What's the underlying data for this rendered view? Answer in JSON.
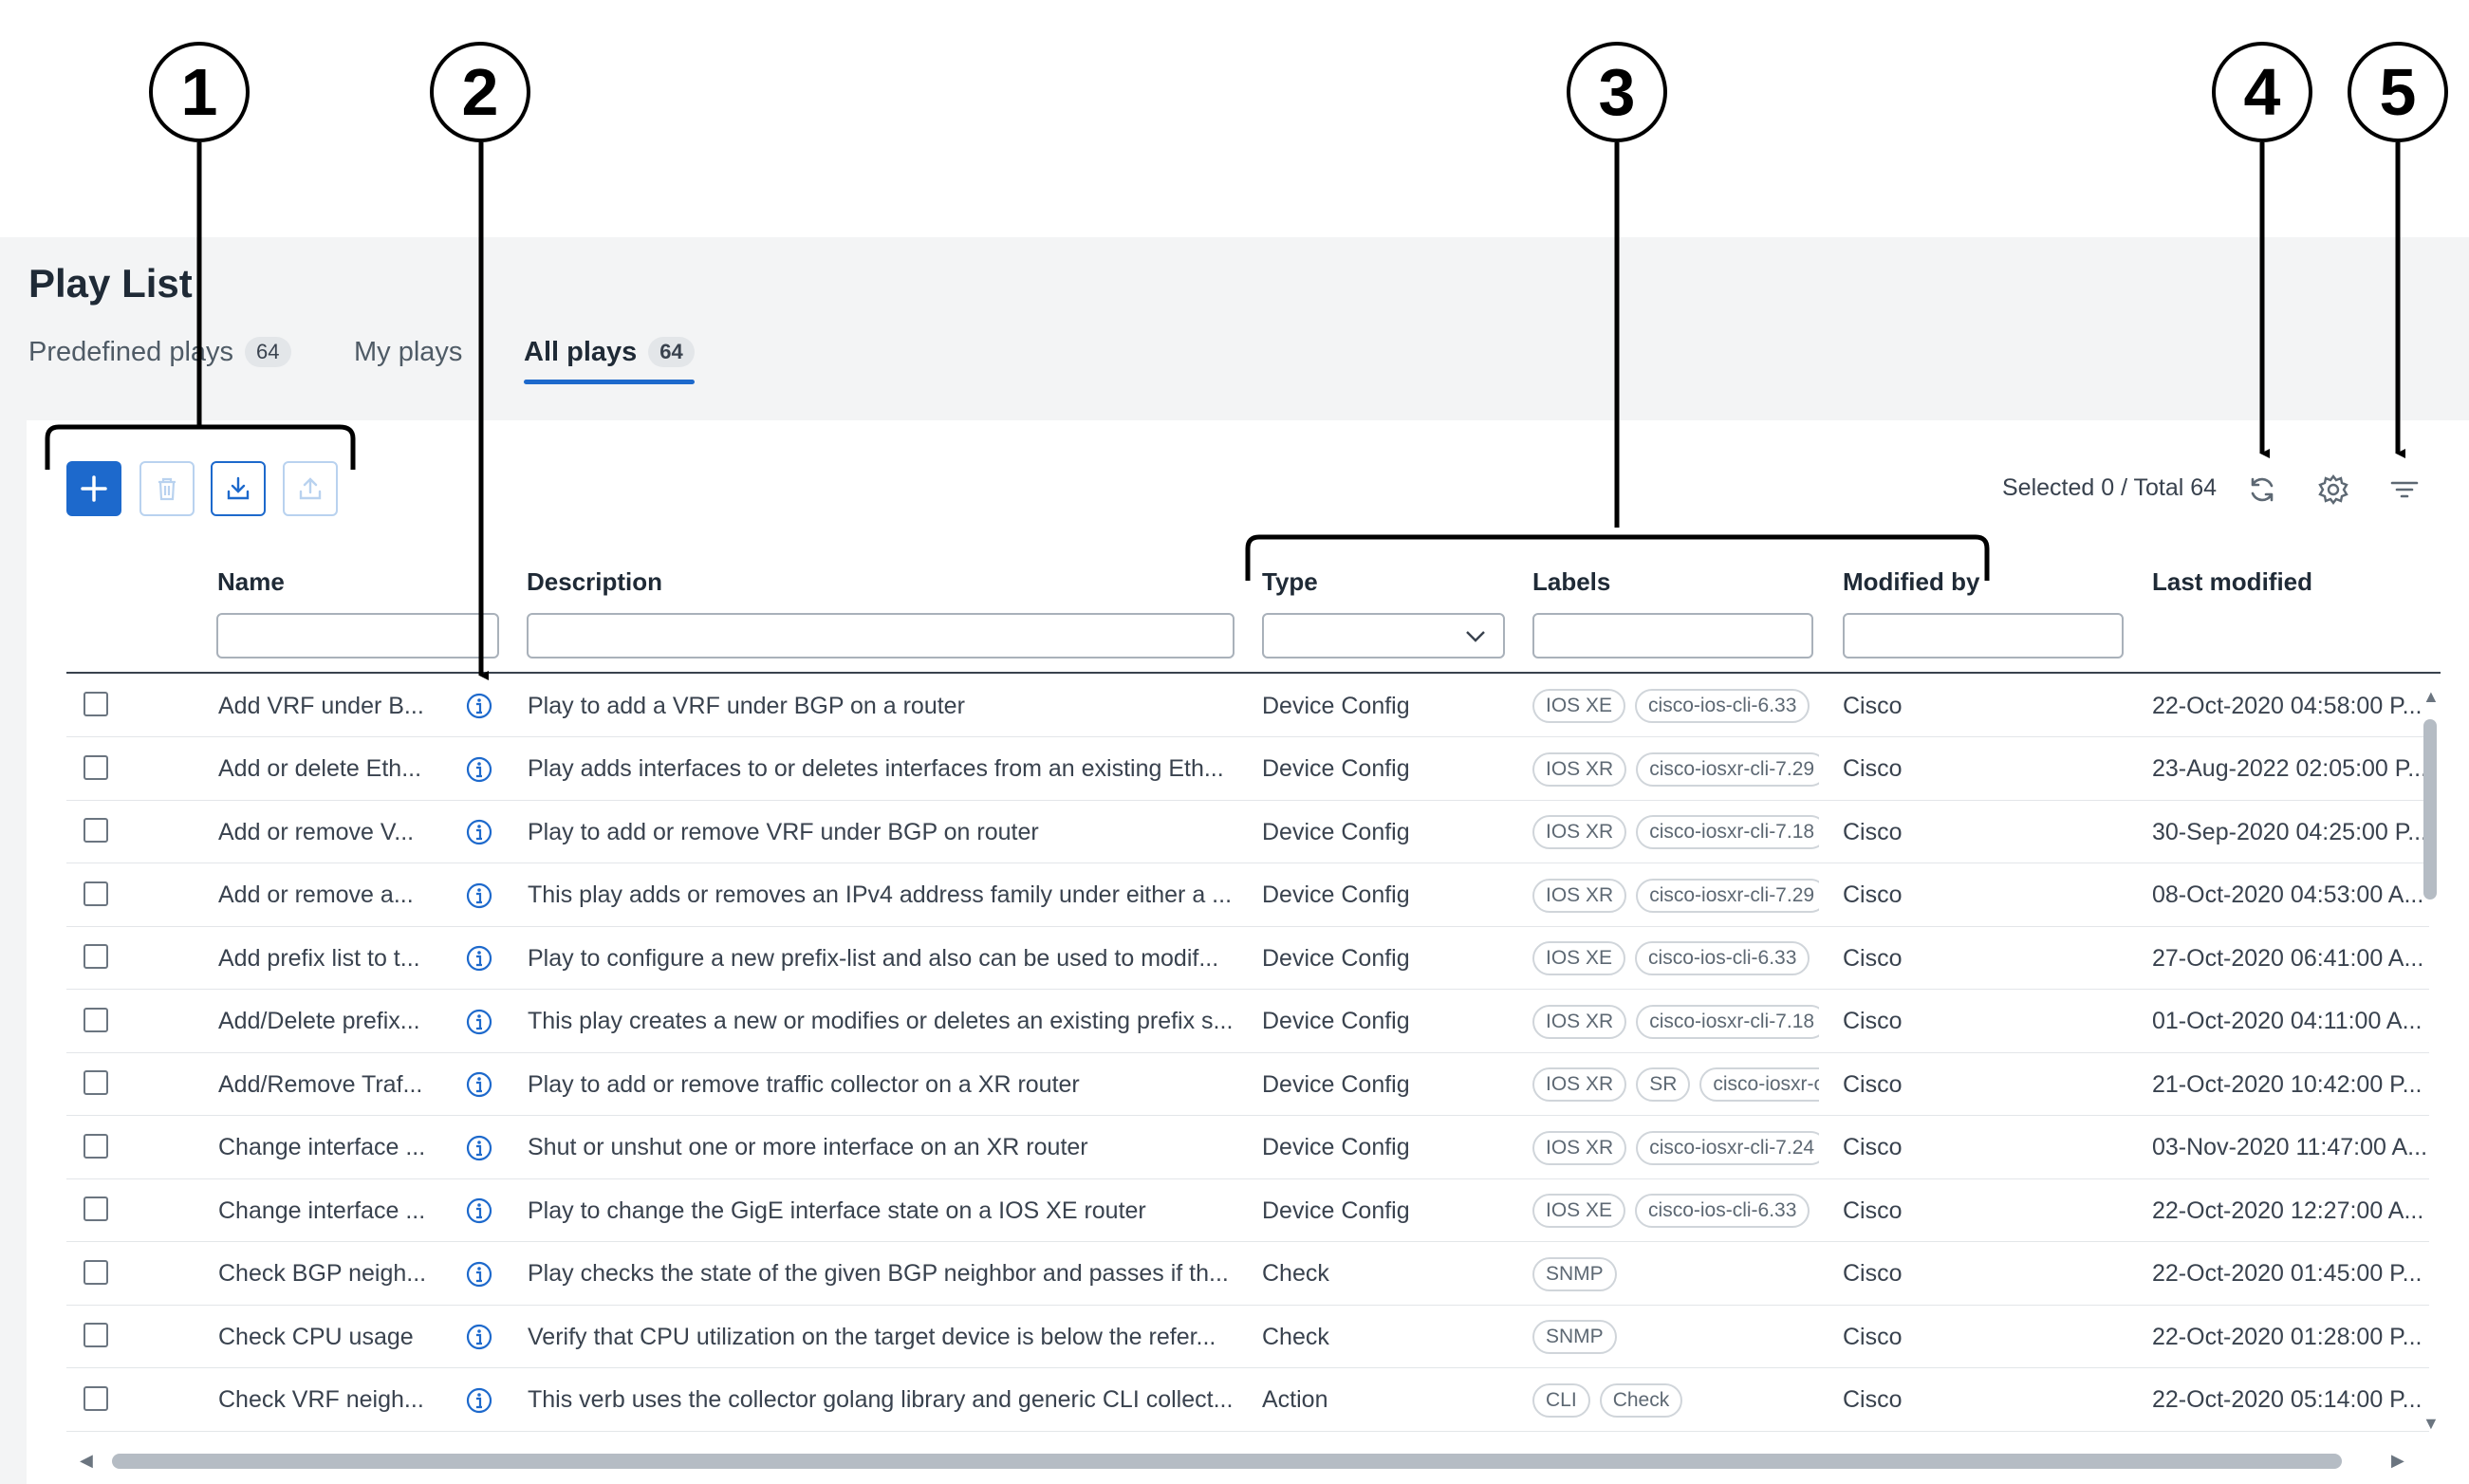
{
  "callouts": [
    "1",
    "2",
    "3",
    "4",
    "5"
  ],
  "page": {
    "title": "Play List"
  },
  "tabs": [
    {
      "label": "Predefined plays",
      "count": "64"
    },
    {
      "label": "My plays",
      "count": ""
    },
    {
      "label": "All plays",
      "count": "64",
      "active": true
    }
  ],
  "toolbar": {
    "add_icon": "plus-icon",
    "delete_icon": "trash-icon",
    "import_icon": "download-icon",
    "export_icon": "upload-icon"
  },
  "summary": {
    "selected_label": "Selected 0 / Total 64"
  },
  "header_icons": [
    "refresh-icon",
    "gear-icon",
    "filter-icon"
  ],
  "columns": {
    "name": "Name",
    "description": "Description",
    "type": "Type",
    "labels": "Labels",
    "modified_by": "Modified by",
    "last_modified": "Last modified"
  },
  "colors": {
    "accent": "#1d69cc",
    "info_icon": "#1d69cc"
  },
  "rows": [
    {
      "name": "Add VRF under B...",
      "description": "Play to add a VRF under BGP on a router",
      "type": "Device Config",
      "labels": [
        "IOS XE",
        "cisco-ios-cli-6.33"
      ],
      "modified_by": "Cisco",
      "last_modified": "22-Oct-2020 04:58:00 P..."
    },
    {
      "name": "Add or delete Eth...",
      "description": "Play adds interfaces to or deletes interfaces from an existing Eth...",
      "type": "Device Config",
      "labels": [
        "IOS XR",
        "cisco-iosxr-cli-7.29"
      ],
      "modified_by": "Cisco",
      "last_modified": "23-Aug-2022 02:05:00 P..."
    },
    {
      "name": "Add or remove V...",
      "description": "Play to add or remove VRF under BGP on router",
      "type": "Device Config",
      "labels": [
        "IOS XR",
        "cisco-iosxr-cli-7.18"
      ],
      "modified_by": "Cisco",
      "last_modified": "30-Sep-2020 04:25:00 P..."
    },
    {
      "name": "Add or remove a...",
      "description": "This play adds or removes an IPv4 address family under either a ...",
      "type": "Device Config",
      "labels": [
        "IOS XR",
        "cisco-iosxr-cli-7.29"
      ],
      "modified_by": "Cisco",
      "last_modified": "08-Oct-2020 04:53:00 A..."
    },
    {
      "name": "Add prefix list to t...",
      "description": "Play to configure a new prefix-list and also can be used to modif...",
      "type": "Device Config",
      "labels": [
        "IOS XE",
        "cisco-ios-cli-6.33"
      ],
      "modified_by": "Cisco",
      "last_modified": "27-Oct-2020 06:41:00 A..."
    },
    {
      "name": "Add/Delete prefix...",
      "description": "This play creates a new or modifies or deletes an existing prefix s...",
      "type": "Device Config",
      "labels": [
        "IOS XR",
        "cisco-iosxr-cli-7.18"
      ],
      "modified_by": "Cisco",
      "last_modified": "01-Oct-2020 04:11:00 A..."
    },
    {
      "name": "Add/Remove Traf...",
      "description": "Play to add or remove traffic collector on a XR router",
      "type": "Device Config",
      "labels": [
        "IOS XR",
        "SR",
        "cisco-iosxr-cli-"
      ],
      "modified_by": "Cisco",
      "last_modified": "21-Oct-2020 10:42:00 P..."
    },
    {
      "name": "Change interface ...",
      "description": "Shut or unshut one or more interface on an XR router",
      "type": "Device Config",
      "labels": [
        "IOS XR",
        "cisco-iosxr-cli-7.24"
      ],
      "modified_by": "Cisco",
      "last_modified": "03-Nov-2020 11:47:00 A..."
    },
    {
      "name": "Change interface ...",
      "description": "Play to change the GigE interface state on a IOS XE router",
      "type": "Device Config",
      "labels": [
        "IOS XE",
        "cisco-ios-cli-6.33"
      ],
      "modified_by": "Cisco",
      "last_modified": "22-Oct-2020 12:27:00 A..."
    },
    {
      "name": "Check BGP neigh...",
      "description": "Play checks the state of the given BGP neighbor and passes if th...",
      "type": "Check",
      "labels": [
        "SNMP"
      ],
      "modified_by": "Cisco",
      "last_modified": "22-Oct-2020 01:45:00 P..."
    },
    {
      "name": "Check CPU usage",
      "description": "Verify that CPU utilization on the target device is below the refer...",
      "type": "Check",
      "labels": [
        "SNMP"
      ],
      "modified_by": "Cisco",
      "last_modified": "22-Oct-2020 01:28:00 P..."
    },
    {
      "name": "Check VRF neigh...",
      "description": "This verb uses the collector golang library and generic CLI collect...",
      "type": "Action",
      "labels": [
        "CLI",
        "Check"
      ],
      "modified_by": "Cisco",
      "last_modified": "22-Oct-2020 05:14:00 P..."
    }
  ]
}
